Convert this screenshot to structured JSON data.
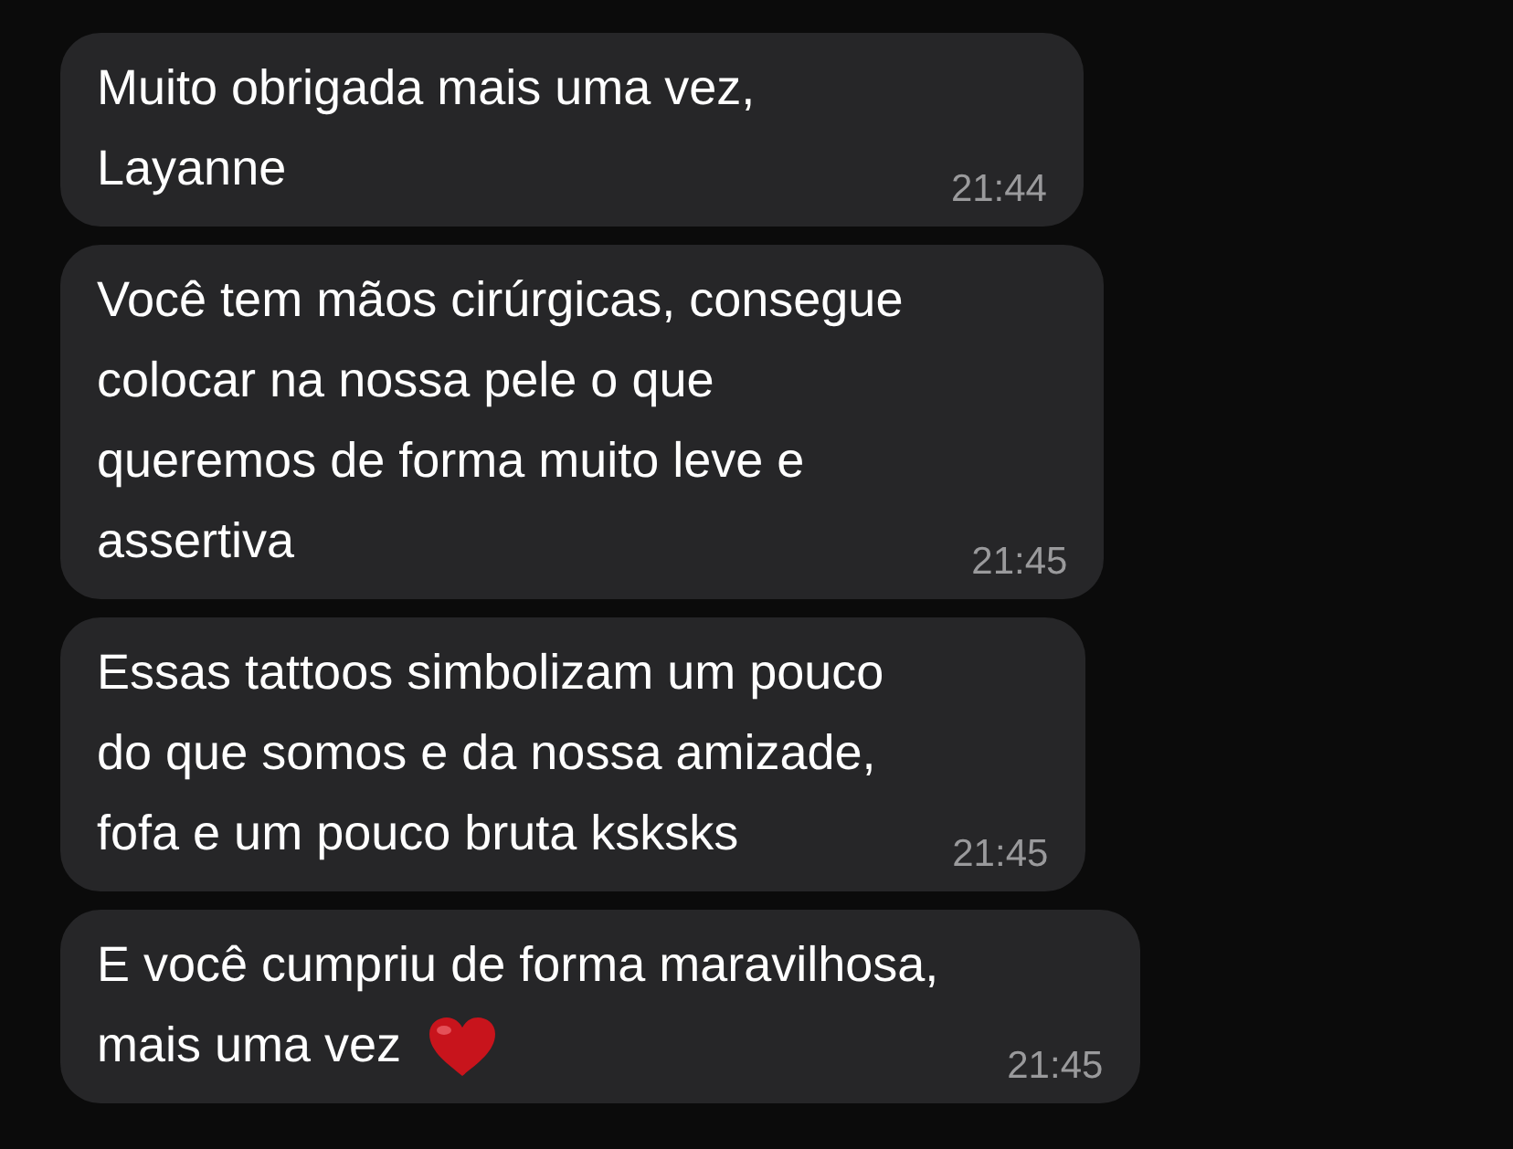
{
  "messages": [
    {
      "lines": [
        "Muito obrigada mais uma vez,",
        "Layanne"
      ],
      "time": "21:44"
    },
    {
      "lines": [
        "Você tem mãos cirúrgicas, consegue",
        "colocar na nossa pele o que",
        "queremos de forma muito leve e",
        "assertiva"
      ],
      "time": "21:45"
    },
    {
      "lines": [
        "Essas tattoos simbolizam um pouco",
        "do que somos e da nossa amizade,",
        "fofa e um pouco bruta ksksks"
      ],
      "time": "21:45"
    },
    {
      "lines": [
        "E você cumpriu de forma maravilhosa,",
        "mais uma vez"
      ],
      "time": "21:45",
      "heart_after": true
    }
  ]
}
